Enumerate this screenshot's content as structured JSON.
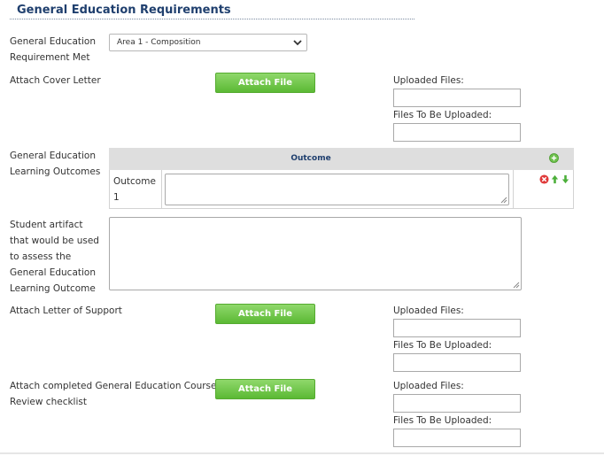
{
  "section": {
    "title": "General Education Requirements"
  },
  "fields": {
    "gen_ed_met": {
      "label_line1": "General Education",
      "label_line2": "Requirement Met",
      "selected": "Area 1 - Composition"
    },
    "cover_letter": {
      "label": "Attach Cover Letter",
      "button": "Attach File",
      "uploaded_label": "Uploaded Files:",
      "to_upload_label": "Files To Be Uploaded:"
    },
    "outcomes": {
      "label_line1": "General Education",
      "label_line2": "Learning Outcomes",
      "column_header": "Outcome",
      "row_label_line1": "Outcome",
      "row_label_line2": "1",
      "row_value": ""
    },
    "artifact": {
      "label_lines": [
        "Student artifact",
        "that would be used",
        "to assess the",
        "General Education",
        "Learning Outcome"
      ],
      "value": ""
    },
    "support_letter": {
      "label": "Attach Letter of Support",
      "button": "Attach File",
      "uploaded_label": "Uploaded Files:",
      "to_upload_label": "Files To Be Uploaded:"
    },
    "checklist": {
      "label_line1": "Attach completed General Education Course",
      "label_line2": "Review checklist",
      "button": "Attach File",
      "uploaded_label": "Uploaded Files:",
      "to_upload_label": "Files To Be Uploaded:"
    }
  },
  "colors": {
    "title": "#1f3f6e",
    "button": "#5bb934",
    "delete": "#e03a3a",
    "move": "#4caf3a",
    "add": "#6cbf4a"
  },
  "icons": {
    "add": "plus-circle-icon",
    "delete": "x-circle-icon",
    "up": "arrow-up-icon",
    "down": "arrow-down-icon",
    "dropdown": "chevron-down-icon"
  }
}
